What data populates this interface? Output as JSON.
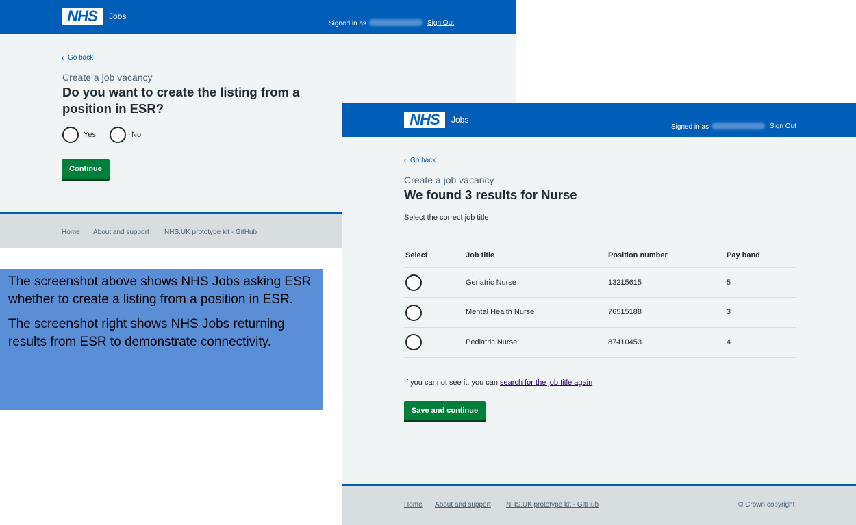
{
  "colors": {
    "nhs_blue": "#005eb8",
    "page_bg": "#f0f4f5",
    "button_green": "#007f3b",
    "footer_grey": "#d8dde0",
    "note_bg": "#5a8fd8",
    "link_purple": "#330072"
  },
  "header": {
    "logo": "NHS",
    "service": "Jobs",
    "signed_in_label": "Signed in as",
    "sign_out": "Sign Out"
  },
  "screen_esr_question": {
    "go_back": "Go back",
    "caption": "Create a job vacancy",
    "heading": "Do you want to create the listing from a position in ESR?",
    "options": [
      "Yes",
      "No"
    ],
    "continue": "Continue",
    "footer_links": [
      "Home",
      "About and support",
      "NHS.UK prototype kit - GitHub"
    ]
  },
  "screen_results": {
    "go_back": "Go back",
    "caption": "Create a job vacancy",
    "heading": "We found 3 results for Nurse",
    "instruction": "Select the correct job title",
    "columns": [
      "Select",
      "Job title",
      "Position number",
      "Pay band"
    ],
    "rows": [
      {
        "job_title": "Geriatric Nurse",
        "position_number": "13215615",
        "pay_band": "5"
      },
      {
        "job_title": "Mental Health Nurse",
        "position_number": "76515188",
        "pay_band": "3"
      },
      {
        "job_title": "Pediatric Nurse",
        "position_number": "87410453",
        "pay_band": "4"
      }
    ],
    "cannot_see_prefix": "If you cannot see it, you can",
    "search_again_link": "search for the job title again",
    "save_continue": "Save and continue",
    "footer_links": [
      "Home",
      "About and support",
      "NHS.UK prototype kit - GitHub"
    ],
    "copyright": "© Crown copyright"
  },
  "note": {
    "paragraphs": [
      "The screenshot above shows NHS Jobs asking ESR whether to create a listing from a position in ESR.",
      "The screenshot right shows NHS Jobs returning results from ESR to demonstrate connectivity."
    ]
  }
}
